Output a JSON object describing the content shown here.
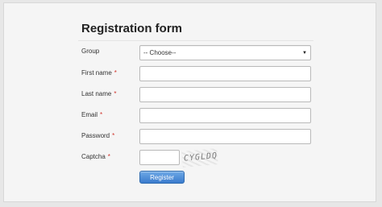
{
  "form": {
    "title": "Registration form",
    "fields": {
      "group": {
        "label": "Group",
        "selected": "-- Choose--"
      },
      "first_name": {
        "label": "First name",
        "required_mark": "*"
      },
      "last_name": {
        "label": "Last name",
        "required_mark": "*"
      },
      "email": {
        "label": "Email",
        "required_mark": "*"
      },
      "password": {
        "label": "Password",
        "required_mark": "*"
      },
      "captcha": {
        "label": "Captcha",
        "required_mark": "*",
        "image_text": "CYGLDQ"
      }
    },
    "register_label": "Register"
  },
  "colors": {
    "required": "#d0342c",
    "button": "#3a7bcd",
    "background": "#f5f5f5"
  },
  "icons": {
    "select_caret": "caret-down-icon"
  }
}
